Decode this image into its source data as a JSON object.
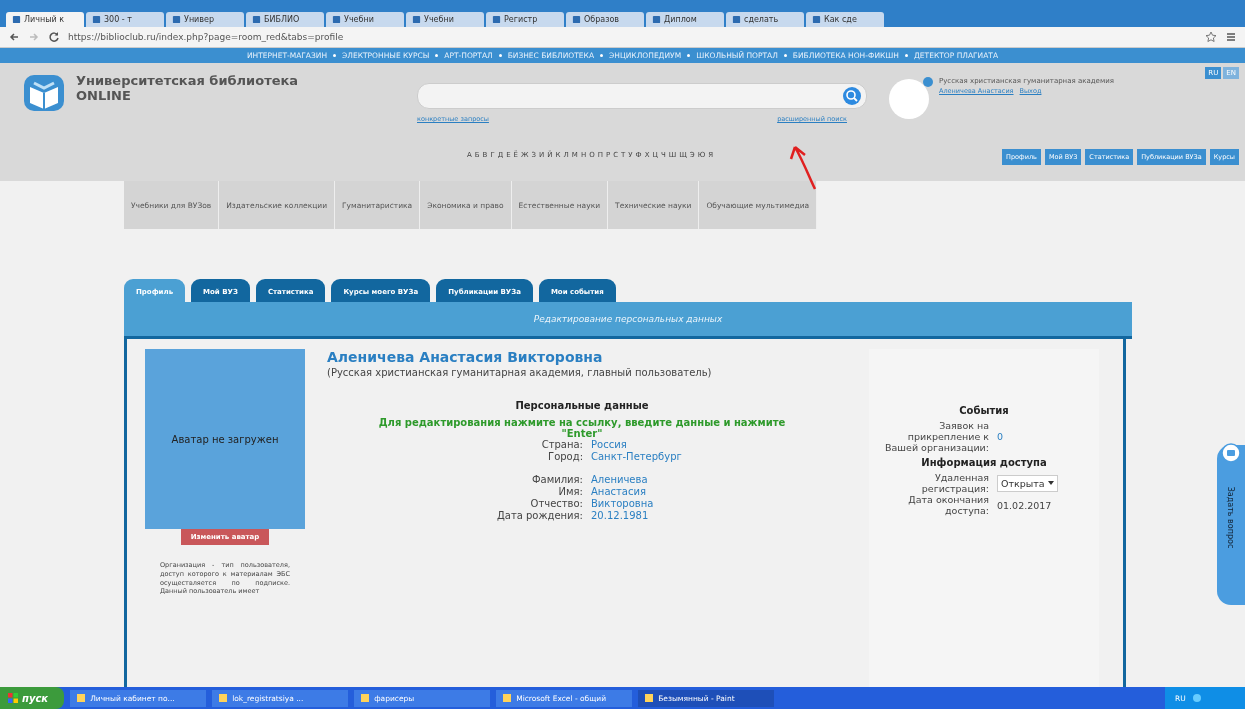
{
  "browser": {
    "tabs": [
      {
        "label": "Личный к",
        "selected": true
      },
      {
        "label": "300 - т",
        "selected": false
      },
      {
        "label": "Универ",
        "selected": false
      },
      {
        "label": "БИБЛИО",
        "selected": false
      },
      {
        "label": "Учебни",
        "selected": false
      },
      {
        "label": "Учебни",
        "selected": false
      },
      {
        "label": "Регистр",
        "selected": false
      },
      {
        "label": "Образов",
        "selected": false
      },
      {
        "label": "Диплом",
        "selected": false
      },
      {
        "label": "сделать",
        "selected": false
      },
      {
        "label": "Как сде",
        "selected": false
      }
    ],
    "url": "https://biblioclub.ru/index.php?page=room_red&tabs=profile"
  },
  "site": {
    "top_nav": [
      "ИНТЕРНЕТ-МАГАЗИН",
      "ЭЛЕКТРОННЫЕ КУРСЫ",
      "АРТ-ПОРТАЛ",
      "БИЗНЕС БИБЛИОТЕКА",
      "ЭНЦИКЛОПЕДИУМ",
      "ШКОЛЬНЫЙ ПОРТАЛ",
      "БИБЛИОТЕКА НОН-ФИКШН",
      "ДЕТЕКТОР ПЛАГИАТА"
    ],
    "logo": {
      "title": "Университетская библиотека",
      "subtitle": "ONLINE"
    },
    "search": {
      "left_link": "конкретные запросы",
      "right_link": "расширенный поиск"
    },
    "alphabet": [
      "А",
      "Б",
      "В",
      "Г",
      "Д",
      "Е",
      "Ё",
      "Ж",
      "З",
      "И",
      "Й",
      "К",
      "Л",
      "М",
      "Н",
      "О",
      "П",
      "Р",
      "С",
      "Т",
      "У",
      "Ф",
      "Х",
      "Ц",
      "Ч",
      "Ш",
      "Щ",
      "Э",
      "Ю",
      "Я"
    ],
    "user": {
      "org": "Русская христианская гуманитарная академия",
      "name": "Аленичева Анастасия",
      "logout": "Выход"
    },
    "languages": [
      {
        "label": "RU",
        "selected": true
      },
      {
        "label": "EN",
        "selected": false
      }
    ],
    "quick_buttons": [
      "Профиль",
      "Мой ВУЗ",
      "Статистика",
      "Публикации ВУЗа",
      "Курсы"
    ],
    "categories": [
      "Учебники для ВУЗов",
      "Издательские коллекции",
      "Гуманитаристика",
      "Экономика и право",
      "Естественные науки",
      "Технические науки",
      "Обучающие мультимедиа"
    ]
  },
  "profile": {
    "tabs": [
      {
        "label": "Профиль",
        "selected": true
      },
      {
        "label": "Мой ВУЗ",
        "selected": false
      },
      {
        "label": "Статистика",
        "selected": false
      },
      {
        "label": "Курсы моего ВУЗа",
        "selected": false
      },
      {
        "label": "Публикации ВУЗа",
        "selected": false
      },
      {
        "label": "Мои события",
        "selected": false
      }
    ],
    "header": "Редактирование персональных данных",
    "avatar": {
      "text": "Аватар не загружен",
      "button": "Изменить аватар"
    },
    "note": "Организация - тип пользователя, доступ которого к материалам ЭБС осуществляется по подписке. Данный пользователь имеет",
    "name": "Аленичева Анастасия Викторовна",
    "affiliation": "(Русская христианская гуманитарная академия, главный пользователь)",
    "personal": {
      "title": "Персональные данные",
      "hint": "Для редактирования нажмите на ссылку, введите данные и нажмите \"Enter\"",
      "groups": [
        [
          {
            "label": "Страна:",
            "value": "Россия"
          },
          {
            "label": "Город:",
            "value": "Санкт-Петербург"
          }
        ],
        [
          {
            "label": "Фамилия:",
            "value": "Аленичева"
          },
          {
            "label": "Имя:",
            "value": "Анастасия"
          },
          {
            "label": "Отчество:",
            "value": "Викторовна"
          },
          {
            "label": "Дата рождения:",
            "value": "20.12.1981"
          }
        ]
      ]
    },
    "events": {
      "title": "События",
      "rows": [
        {
          "label": "Заявок на прикрепление к Вашей организации:",
          "value": "0",
          "kind": "text"
        }
      ]
    },
    "access": {
      "title": "Информация доступа",
      "rows": [
        {
          "label": "Удаленная регистрация:",
          "value": "Открыта",
          "kind": "select"
        },
        {
          "label": "Дата окончания доступа:",
          "value": "01.02.2017",
          "kind": "text"
        }
      ]
    }
  },
  "side_tab": "Задать вопрос",
  "taskbar": {
    "start": "пуск",
    "items": [
      {
        "label": "Личный кабинет по...",
        "selected": false
      },
      {
        "label": "lok_registratsiya ...",
        "selected": false
      },
      {
        "label": "фарисеры",
        "selected": false
      },
      {
        "label": "Microsoft Excel - общий",
        "selected": false
      },
      {
        "label": "Безымянный - Paint",
        "selected": true
      }
    ],
    "lang": "RU"
  }
}
